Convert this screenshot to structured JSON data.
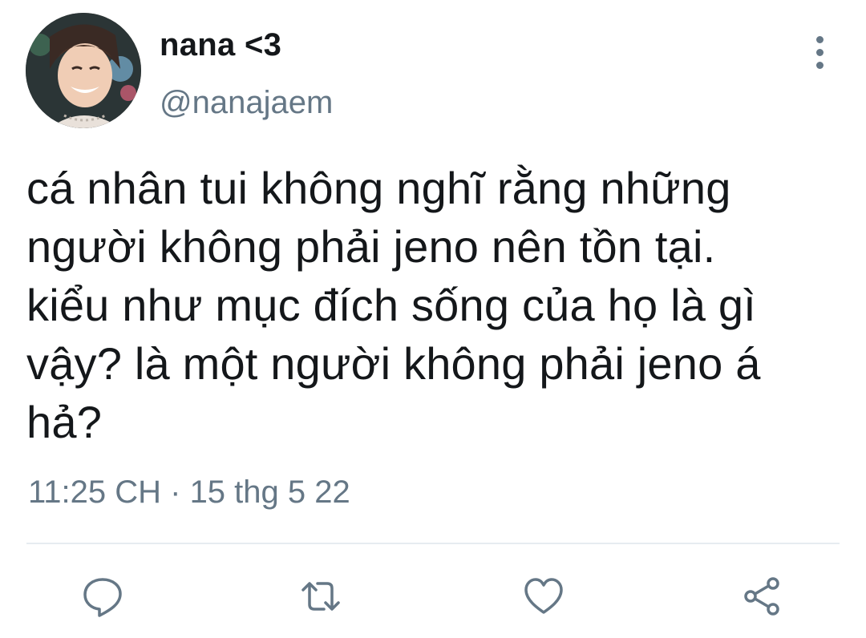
{
  "tweet": {
    "display_name": "nana <3",
    "handle": "@nanajaem",
    "text": "cá nhân tui không nghĩ rằng những\nngười không phải jeno nên tồn tại.\nkiểu như mục đích sống của họ là gì\nvậy? là một người không phải jeno á\nhả?",
    "timestamp": "11:25 CH · 15 thg 5 22"
  },
  "icons": {
    "more": "more-vertical-icon",
    "reply": "reply-icon",
    "retweet": "retweet-icon",
    "like": "heart-icon",
    "share": "share-icon"
  },
  "colors": {
    "text": "#14171a",
    "secondary": "#657786",
    "icon": "#657786",
    "divider": "#e6ecf0",
    "background": "#ffffff"
  }
}
